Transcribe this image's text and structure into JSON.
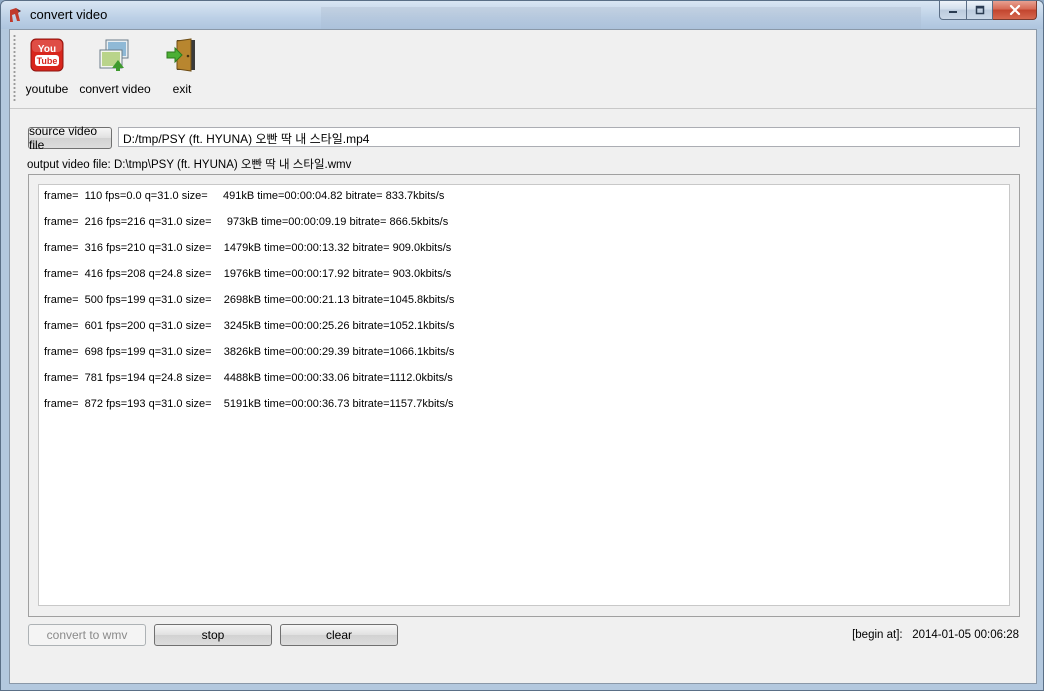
{
  "window": {
    "title": "convert video"
  },
  "toolbar": {
    "youtube_label": "youtube",
    "convert_label": "convert video",
    "exit_label": "exit"
  },
  "source": {
    "button_label": "source video file",
    "path": "D:/tmp/PSY (ft. HYUNA) 오빤 딱 내 스타일.mp4"
  },
  "output": {
    "label": "output video file: D:\\tmp\\PSY (ft. HYUNA) 오빤 딱 내 스타일.wmv"
  },
  "log": {
    "lines": [
      "frame=  110 fps=0.0 q=31.0 size=     491kB time=00:00:04.82 bitrate= 833.7kbits/s",
      "frame=  216 fps=216 q=31.0 size=     973kB time=00:00:09.19 bitrate= 866.5kbits/s",
      "frame=  316 fps=210 q=31.0 size=    1479kB time=00:00:13.32 bitrate= 909.0kbits/s",
      "frame=  416 fps=208 q=24.8 size=    1976kB time=00:00:17.92 bitrate= 903.0kbits/s",
      "frame=  500 fps=199 q=31.0 size=    2698kB time=00:00:21.13 bitrate=1045.8kbits/s",
      "frame=  601 fps=200 q=31.0 size=    3245kB time=00:00:25.26 bitrate=1052.1kbits/s",
      "frame=  698 fps=199 q=31.0 size=    3826kB time=00:00:29.39 bitrate=1066.1kbits/s",
      "frame=  781 fps=194 q=24.8 size=    4488kB time=00:00:33.06 bitrate=1112.0kbits/s",
      "frame=  872 fps=193 q=31.0 size=    5191kB time=00:00:36.73 bitrate=1157.7kbits/s"
    ]
  },
  "buttons": {
    "convert_label": "convert to wmv",
    "stop_label": "stop",
    "clear_label": "clear"
  },
  "status": {
    "begin_label": "[begin at]:",
    "begin_time": "2014-01-05 00:06:28"
  },
  "colors": {
    "youtube_red": "#d8261d",
    "close_red": "#c2452e",
    "exit_door": "#b8862f"
  },
  "icons": {
    "app": "app-logo-icon",
    "youtube": "youtube-icon",
    "convert": "convert-video-icon",
    "exit": "exit-door-icon"
  }
}
